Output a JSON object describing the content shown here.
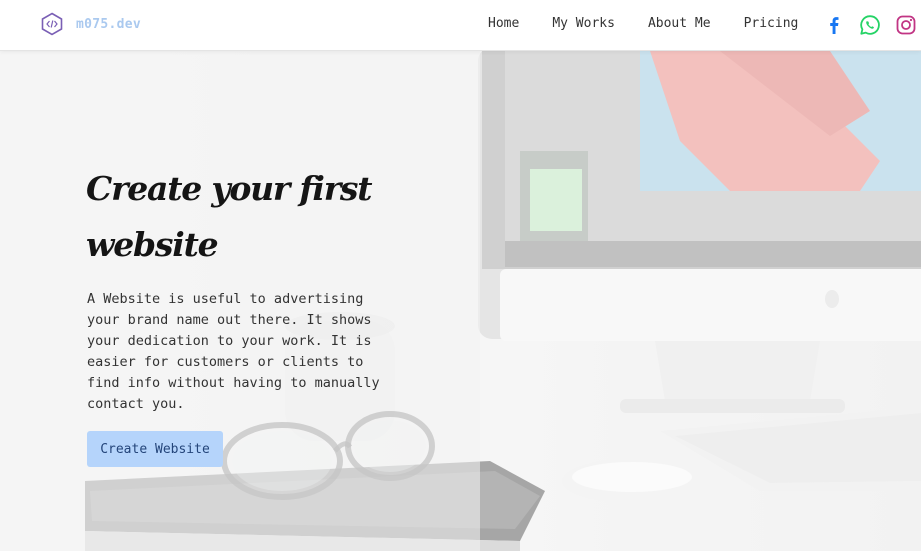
{
  "header": {
    "logo_text": "m075.dev",
    "nav": [
      "Home",
      "My Works",
      "About Me",
      "Pricing"
    ],
    "social_icons": [
      "facebook-icon",
      "whatsapp-icon",
      "instagram-icon"
    ]
  },
  "hero": {
    "title": "Create your first website",
    "description": "A Website is useful to advertising your brand name out there. It shows your dedication to your work. It is easier for customers or clients to find info without having to manually contact you.",
    "cta_label": "Create Website"
  },
  "colors": {
    "accent": "#b5d4fb",
    "logo": "#aac9ef",
    "facebook": "#1877f2",
    "whatsapp": "#25d366",
    "instagram": "#c13584"
  }
}
